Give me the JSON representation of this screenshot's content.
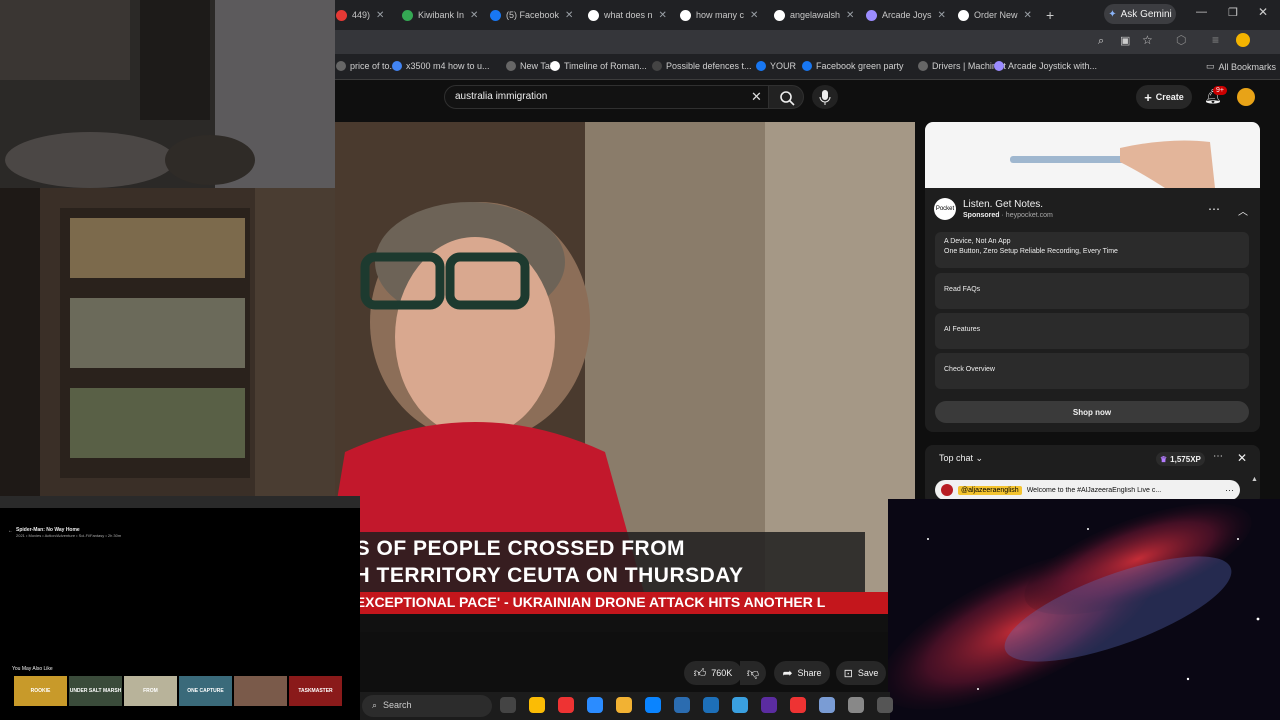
{
  "browser": {
    "tabs": [
      {
        "label": "449)",
        "color": "#e53935"
      },
      {
        "label": "Kiwibank In",
        "color": "#34a853"
      },
      {
        "label": "(5) Facebook",
        "color": "#1877f2"
      },
      {
        "label": "what does n",
        "color": "#ffffff"
      },
      {
        "label": "how many c",
        "color": "#ffffff"
      },
      {
        "label": "angelawalsh",
        "color": "#ffffff"
      },
      {
        "label": "Arcade Joys",
        "color": "#9b8cff"
      },
      {
        "label": "Order New",
        "color": "#ffffff"
      }
    ],
    "new_tab": "+",
    "ask_gemini": "Ask Gemini",
    "bookmarks": [
      "price of to...",
      "x3500 m4 how to u...",
      "New Tab",
      "Timeline of Roman...",
      "Possible defences t...",
      "YOUR",
      "Facebook green party",
      "Drivers | Machinist",
      "Arcade Joystick with..."
    ],
    "all_bookmarks": "All Bookmarks"
  },
  "youtube": {
    "search_value": "australia immigration",
    "create_label": "Create",
    "notif_badge": "9+"
  },
  "video": {
    "ticker_line1": "DS OF PEOPLE CROSSED FROM",
    "ticker_line2": "SH TERRITORY CEUTA ON THURSDAY",
    "red_ticker": "T 'EXCEPTIONAL PACE'   -   UKRAINIAN DRONE ATTACK HITS ANOTHER L"
  },
  "actions": {
    "likes": "760K",
    "share": "Share",
    "save": "Save"
  },
  "ad": {
    "title": "Listen. Get Notes.",
    "sponsored": "Sponsored",
    "domain": "heypocket.com",
    "logo_text": "Pocket",
    "options": [
      {
        "title": "A Device, Not An App",
        "sub": "One Button, Zero Setup Reliable Recording, Every Time"
      },
      {
        "title": "Read FAQs",
        "sub": ""
      },
      {
        "title": "AI Features",
        "sub": ""
      },
      {
        "title": "Check Overview",
        "sub": ""
      }
    ],
    "shop_now": "Shop now"
  },
  "chat": {
    "title": "Top chat",
    "xp": "1,575XP",
    "author": "@aljazeeraenglish",
    "message": "Welcome to the #AlJazeeraEnglish Live c..."
  },
  "mini_player": {
    "title": "Spider-Man: No Way Home",
    "meta": "2021 • Movies • Action/Adventure • Sci-Fi/Fantasy • 2h 30m",
    "section": "You May Also Like",
    "thumbs": [
      "ROOKIE",
      "UNDER SALT MARSH",
      "FROM",
      "ONE CAPTURE",
      "",
      "TASKMASTER"
    ]
  },
  "taskbar": {
    "search_placeholder": "Search"
  }
}
